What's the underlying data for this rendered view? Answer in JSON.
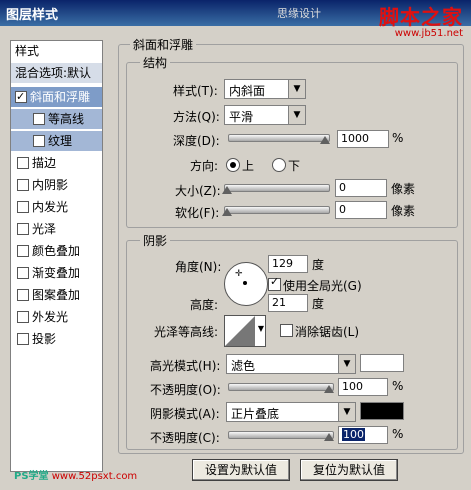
{
  "window": {
    "title": "图层样式",
    "watermark": "思缘设计",
    "logo": "脚本之家",
    "logo_url": "www.jb51.net"
  },
  "sidebar": {
    "header": "样式",
    "blend": "混合选项:默认",
    "items": [
      {
        "label": "斜面和浮雕",
        "checked": true
      },
      {
        "label": "等高线",
        "checked": false
      },
      {
        "label": "纹理",
        "checked": false
      },
      {
        "label": "描边",
        "checked": false
      },
      {
        "label": "内阴影",
        "checked": false
      },
      {
        "label": "内发光",
        "checked": false
      },
      {
        "label": "光泽",
        "checked": false
      },
      {
        "label": "颜色叠加",
        "checked": false
      },
      {
        "label": "渐变叠加",
        "checked": false
      },
      {
        "label": "图案叠加",
        "checked": false
      },
      {
        "label": "外发光",
        "checked": false
      },
      {
        "label": "投影",
        "checked": false
      }
    ]
  },
  "bevel": {
    "group_title": "斜面和浮雕",
    "structure_title": "结构",
    "style_label": "样式(T):",
    "style_value": "内斜面",
    "technique_label": "方法(Q):",
    "technique_value": "平滑",
    "depth_label": "深度(D):",
    "depth_value": "1000",
    "depth_unit": "%",
    "direction_label": "方向:",
    "dir_up": "上",
    "dir_down": "下",
    "size_label": "大小(Z):",
    "size_value": "0",
    "size_unit": "像素",
    "soften_label": "软化(F):",
    "soften_value": "0",
    "soften_unit": "像素"
  },
  "shading": {
    "group_title": "阴影",
    "angle_label": "角度(N):",
    "angle_value": "129",
    "angle_unit": "度",
    "global_light": "使用全局光(G)",
    "altitude_label": "高度:",
    "altitude_value": "21",
    "altitude_unit": "度",
    "gloss_label": "光泽等高线:",
    "antialias": "消除锯齿(L)",
    "highlight_label": "高光模式(H):",
    "highlight_mode": "滤色",
    "highlight_color": "#ffffff",
    "opacity1_label": "不透明度(O):",
    "opacity1_value": "100",
    "shadow_label": "阴影模式(A):",
    "shadow_mode": "正片叠底",
    "shadow_color": "#000000",
    "opacity2_label": "不透明度(C):",
    "opacity2_value": "100",
    "pct": "%"
  },
  "buttons": {
    "make_default": "设置为默认值",
    "reset_default": "复位为默认值"
  },
  "footer": {
    "brand": "PS学堂",
    "url": "www.52psxt.com"
  }
}
